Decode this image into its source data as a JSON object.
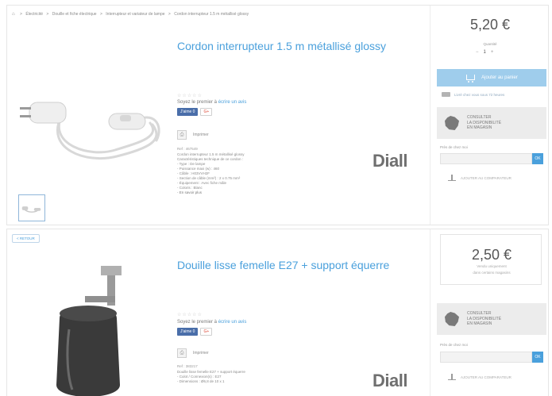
{
  "product1": {
    "breadcrumb": [
      "Électricité",
      "Douille et fiche électrique",
      "Interrupteur et variateur de lampe",
      "Cordon interrupteur 1.5 m métallisé glossy"
    ],
    "title": "Cordon interrupteur 1.5 m métallisé glossy",
    "stars": "☆☆☆☆☆",
    "review_prefix": "Soyez le premier à ",
    "review_link": "écrire un avis",
    "fb_like": "J'aime 0",
    "gplus": "G+",
    "print": "Imprimer",
    "ref": "Ref : 467549",
    "description": [
      "Cordon interrupteur 1.5 m métallisé glossy",
      "Caractéristiques technique de ce cordon :",
      "- Type : De lampe",
      "- Puissance maxi (w) : 460",
      "- Câble : H03VVH2F",
      "- Section de câble (mm²) : 2 x 0.75 mm²",
      "- Équipement : Avec fiche mâle",
      "- Coloris : Blanc"
    ],
    "more": "- En savoir plus",
    "brand": "Diall",
    "price": "5,20 €",
    "qty_label": "Quantité",
    "qty_minus": "−",
    "qty_value": "1",
    "qty_plus": "+",
    "add_to_cart": "Ajouter au panier",
    "delivery": "Livré chez vous sous 72 heures",
    "store_button": "CONSULTER\nLA DISPONIBILITÉ\nEN MAGASIN",
    "near_label": "Près de chez moi",
    "ok": "OK",
    "compare": "AJOUTER AU COMPARATEUR"
  },
  "product2": {
    "back": "< RETOUR",
    "title": "Douille lisse femelle E27 + support équerre",
    "stars": "☆☆☆☆☆",
    "review_prefix": "Soyez le premier à ",
    "review_link": "écrire un avis",
    "fb_like": "J'aime 0",
    "gplus": "G+",
    "print": "Imprimer",
    "ref": "Ref : 383217",
    "description": [
      "Douille lisse femelle E27 + support équerre",
      "- Culot / Connexion(s) : E27",
      "- Dimensions : Ø6,8 de 10 x 1"
    ],
    "brand": "Diall",
    "price": "2,50 €",
    "sold_text": "Vendu uniquement\ndans certains magasins",
    "store_button": "CONSULTER\nLA DISPONIBILITÉ\nEN MAGASIN",
    "near_label": "Près de chez moi",
    "ok": "OK",
    "compare": "AJOUTER AU COMPARATEUR"
  },
  "colors": {
    "accent": "#4aa0dc",
    "cart_button": "#9fcdec",
    "facebook": "#4a6ea9"
  },
  "icons": [
    "home-icon",
    "cart-icon",
    "truck-icon",
    "france-map-icon",
    "compare-scale-icon"
  ]
}
